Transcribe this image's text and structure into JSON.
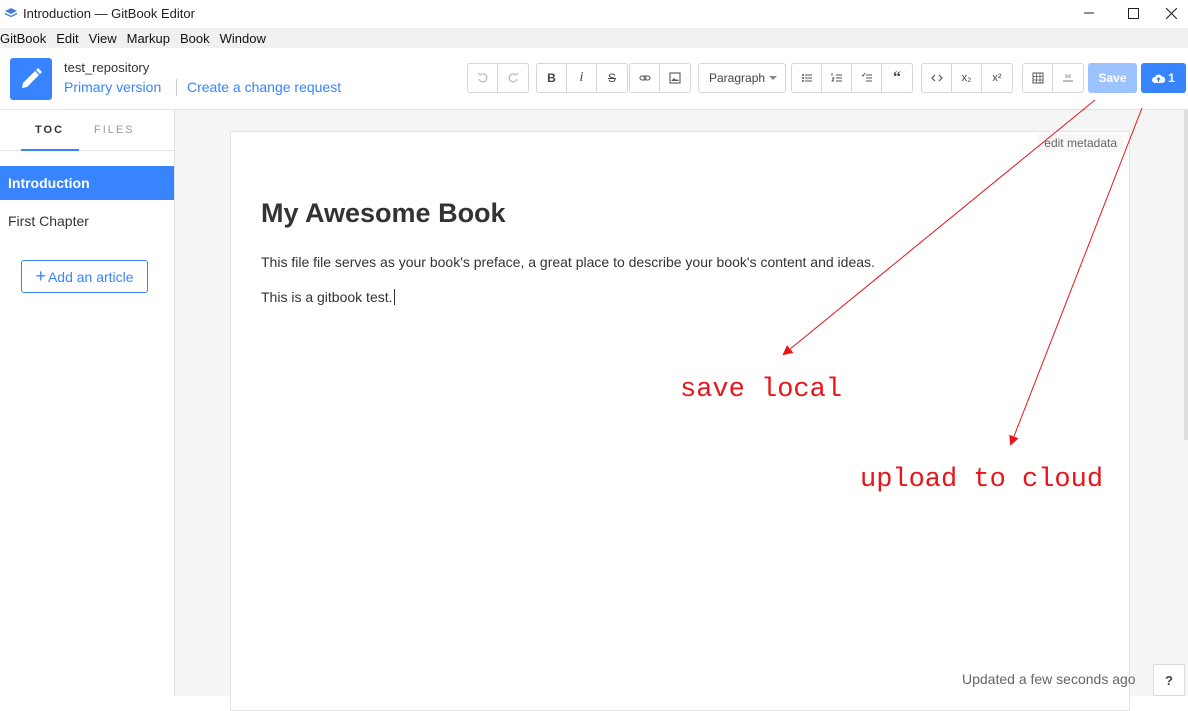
{
  "window": {
    "title": "Introduction — GitBook Editor",
    "minimize_icon": "minimize-icon",
    "maximize_icon": "maximize-icon",
    "close_icon": "close-icon"
  },
  "menubar": [
    "GitBook",
    "Edit",
    "View",
    "Markup",
    "Book",
    "Window"
  ],
  "header": {
    "repo_name": "test_repository",
    "branch": "Primary version",
    "change_request": "Create a change request",
    "paragraph_select": "Paragraph",
    "save_label": "Save",
    "upload_count": "1",
    "accent": "#3884ff",
    "save_bg": "#9cc3ff"
  },
  "toolbar": {
    "undo": "undo-icon",
    "redo": "redo-icon",
    "bold": "B",
    "italic": "i",
    "strike": "S",
    "link": "link-icon",
    "image": "image-icon",
    "bullet_list": "bullet-list-icon",
    "numbered_list": "numbered-list-icon",
    "task_list": "task-list-icon",
    "quote": "“",
    "code": "code-icon",
    "subscript": "x₂",
    "superscript": "x²",
    "table": "table-icon",
    "footnote": "footnote-icon"
  },
  "sidebar": {
    "tabs": [
      "TOC",
      "FILES"
    ],
    "items": [
      {
        "label": "Introduction",
        "active": true
      },
      {
        "label": "First Chapter",
        "active": false
      }
    ],
    "add_article": "Add an article"
  },
  "editor": {
    "edit_metadata": "edit metadata",
    "title": "My Awesome Book",
    "paragraphs": [
      "This file file serves as your book's preface, a great place to describe your book's content and ideas.",
      "This is a gitbook test."
    ],
    "status": "Updated a few seconds ago",
    "help": "?"
  },
  "annotations": {
    "save_local": "save local",
    "upload_cloud": "upload to cloud",
    "color": "#e8151b"
  }
}
